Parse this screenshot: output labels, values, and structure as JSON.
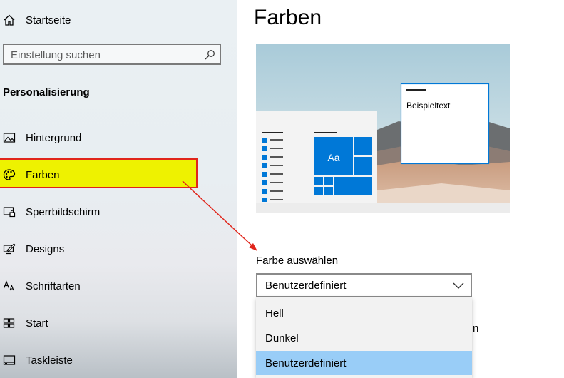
{
  "sidebar": {
    "home_label": "Startseite",
    "search_placeholder": "Einstellung suchen",
    "section_title": "Personalisierung",
    "items": [
      {
        "label": "Hintergrund",
        "icon": "picture-icon"
      },
      {
        "label": "Farben",
        "icon": "palette-icon"
      },
      {
        "label": "Sperrbildschirm",
        "icon": "lock-screen-icon"
      },
      {
        "label": "Designs",
        "icon": "designs-icon"
      },
      {
        "label": "Schriftarten",
        "icon": "fonts-icon"
      },
      {
        "label": "Start",
        "icon": "start-icon"
      },
      {
        "label": "Taskleiste",
        "icon": "taskbar-icon"
      }
    ]
  },
  "main": {
    "title": "Farben",
    "preview": {
      "sample_text": "Beispieltext",
      "tile_text": "Aa"
    },
    "color_section": {
      "label": "Farbe auswählen",
      "selected": "Benutzerdefiniert",
      "options": [
        "Hell",
        "Dunkel",
        "Benutzerdefiniert"
      ],
      "partially_hidden_text": "n"
    }
  },
  "colors": {
    "accent": "#0078d7",
    "highlight_fill": "#eef200",
    "annotation_red": "#e0251b",
    "dropdown_selected": "#99cdf7"
  }
}
